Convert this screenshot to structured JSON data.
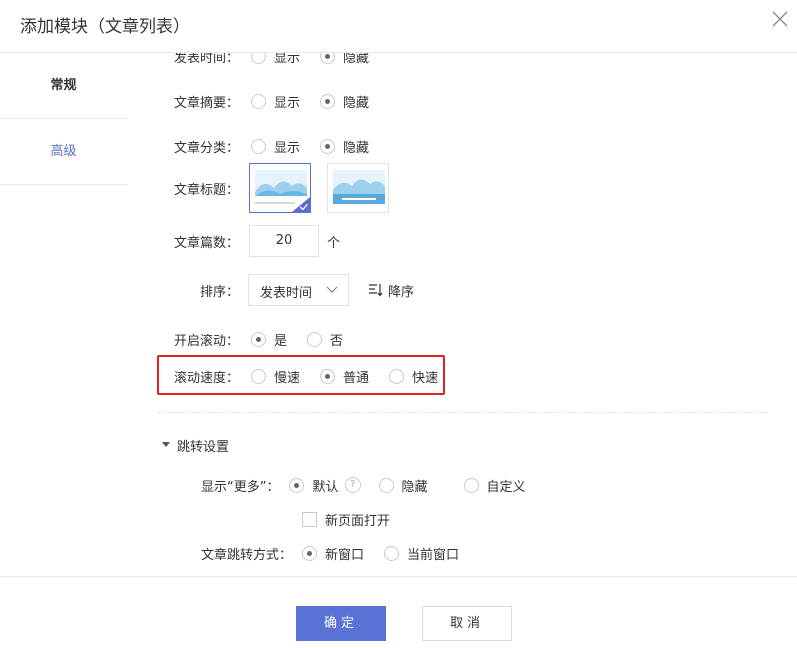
{
  "dialog": {
    "title": "添加模块（文章列表）"
  },
  "sidebar": {
    "tabs": [
      {
        "label": "常规"
      },
      {
        "label": "高级"
      }
    ]
  },
  "form": {
    "publish_time": {
      "label": "发表时间：",
      "options": [
        "显示",
        "隐藏"
      ],
      "selected": "隐藏"
    },
    "summary": {
      "label": "文章摘要：",
      "options": [
        "显示",
        "隐藏"
      ],
      "selected": "隐藏"
    },
    "category": {
      "label": "文章分类：",
      "options": [
        "显示",
        "隐藏"
      ],
      "selected": "隐藏"
    },
    "title_style": {
      "label": "文章标题："
    },
    "count": {
      "label": "文章篇数：",
      "value": "20",
      "unit": "个"
    },
    "sort": {
      "label": "排序：",
      "value": "发表时间",
      "order": "降序"
    },
    "scroll": {
      "label": "开启滚动：",
      "options": [
        "是",
        "否"
      ],
      "selected": "是"
    },
    "speed": {
      "label": "滚动速度：",
      "options": [
        "慢速",
        "普通",
        "快速"
      ],
      "selected": "普通"
    }
  },
  "jump": {
    "section_title": "跳转设置",
    "more": {
      "label": "显示“更多”：",
      "options": [
        "默认",
        "隐藏",
        "自定义"
      ],
      "selected": "默认",
      "help": "?"
    },
    "new_page": {
      "label": "新页面打开"
    },
    "method": {
      "label": "文章跳转方式：",
      "options": [
        "新窗口",
        "当前窗口"
      ],
      "selected": "新窗口"
    }
  },
  "footer": {
    "ok": "确定",
    "cancel": "取消"
  },
  "colors": {
    "accent": "#5a72d6",
    "highlight": "#e0231f"
  }
}
